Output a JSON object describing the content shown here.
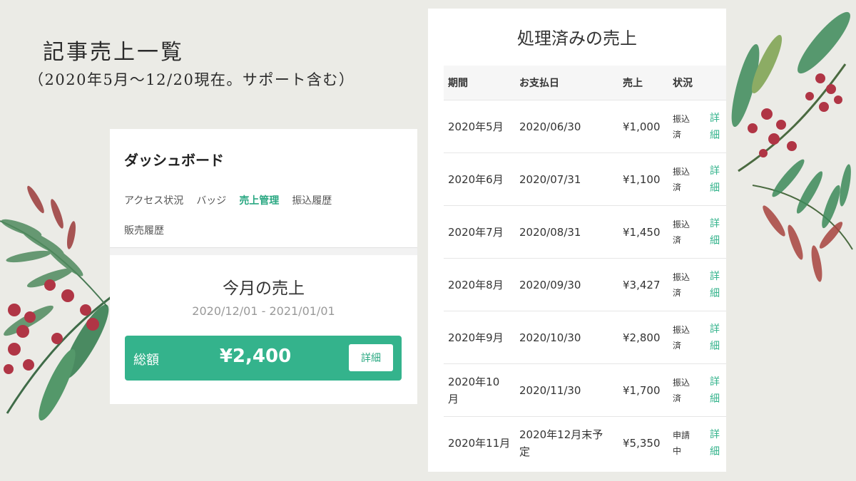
{
  "page": {
    "title": "記事売上一覧",
    "subtitle": "（2020年5月〜12/20現在。サポート含む）"
  },
  "dashboard": {
    "title": "ダッシュボード",
    "tabs": [
      {
        "label": "アクセス状況",
        "active": false
      },
      {
        "label": "バッジ",
        "active": false
      },
      {
        "label": "売上管理",
        "active": true
      },
      {
        "label": "振込履歴",
        "active": false
      },
      {
        "label": "販売履歴",
        "active": false
      }
    ],
    "month_title": "今月の売上",
    "month_range": "2020/12/01 - 2021/01/01",
    "total_label": "総額",
    "total_amount": "¥2,400",
    "detail_button": "詳細"
  },
  "sales": {
    "title": "処理済みの売上",
    "headers": {
      "period": "期間",
      "date": "お支払日",
      "amount": "売上",
      "status": "状況"
    },
    "rows": [
      {
        "period": "2020年5月",
        "date": "2020/06/30",
        "amount": "¥1,000",
        "status": "振込\n済",
        "detail": "詳\n細"
      },
      {
        "period": "2020年6月",
        "date": "2020/07/31",
        "amount": "¥1,100",
        "status": "振込\n済",
        "detail": "詳\n細"
      },
      {
        "period": "2020年7月",
        "date": "2020/08/31",
        "amount": "¥1,450",
        "status": "振込\n済",
        "detail": "詳\n細"
      },
      {
        "period": "2020年8月",
        "date": "2020/09/30",
        "amount": "¥3,427",
        "status": "振込\n済",
        "detail": "詳\n細"
      },
      {
        "period": "2020年9月",
        "date": "2020/10/30",
        "amount": "¥2,800",
        "status": "振込\n済",
        "detail": "詳\n細"
      },
      {
        "period": "2020年10\n月",
        "date": "2020/11/30",
        "amount": "¥1,700",
        "status": "振込\n済",
        "detail": "詳\n細"
      },
      {
        "period": "2020年11月",
        "date": "2020年12月末予\n定",
        "amount": "¥5,350",
        "status": "申請\n中",
        "detail": "詳\n細"
      }
    ]
  },
  "colors": {
    "accent": "#34b38c",
    "background": "#ebebe6"
  },
  "decorations": [
    "watercolor-fern-leaves",
    "red-berries"
  ]
}
